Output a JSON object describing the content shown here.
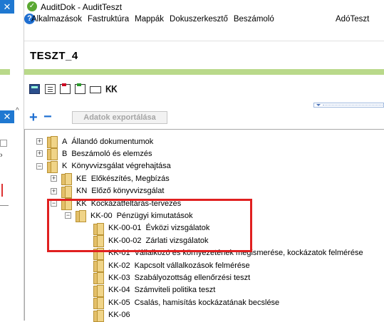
{
  "window": {
    "title": "AuditDok - AuditTeszt"
  },
  "menu": {
    "items": [
      "Alkalmazások",
      "Fastruktúra",
      "Mappák",
      "Dokuszerkesztő",
      "Beszámoló"
    ],
    "right_item": "AdóTeszt"
  },
  "document": {
    "title": "TESZT_4"
  },
  "toolbar": {
    "kk_label": "KK"
  },
  "actions": {
    "export_label": "Adatok exportálása"
  },
  "tree": {
    "nodes": [
      {
        "code": "A",
        "label": "Állandó dokumentumok",
        "level": 0,
        "expander": "+"
      },
      {
        "code": "B",
        "label": "Beszámoló és elemzés",
        "level": 0,
        "expander": "+"
      },
      {
        "code": "K",
        "label": "Könyvvizsgálat végrehajtása",
        "level": 0,
        "expander": "−"
      },
      {
        "code": "KE",
        "label": "Előkészítés, Megbízás",
        "level": 1,
        "expander": "+"
      },
      {
        "code": "KN",
        "label": "Előző könyvvizsgálat",
        "level": 1,
        "expander": "+"
      },
      {
        "code": "KK",
        "label": "Kockázatfeltárás-tervezés",
        "level": 1,
        "expander": "−"
      },
      {
        "code": "KK-00",
        "label": "Pénzügyi kimutatások",
        "level": 2,
        "expander": "−"
      },
      {
        "code": "KK-00-01",
        "label": "Évközi vizsgálatok",
        "level": 3,
        "expander": ""
      },
      {
        "code": "KK-00-02",
        "label": "Zárlati vizsgálatok",
        "level": 3,
        "expander": ""
      },
      {
        "code": "KK-01",
        "label": "Vállalkozó és környezetének megismerése, kockázatok felmérése",
        "level": 3,
        "expander": ""
      },
      {
        "code": "KK-02",
        "label": "Kapcsolt vállalkozások felmérése",
        "level": 3,
        "expander": ""
      },
      {
        "code": "KK-03",
        "label": "Szabályozottság ellenőrzési teszt",
        "level": 3,
        "expander": ""
      },
      {
        "code": "KK-04",
        "label": "Számviteli politika teszt",
        "level": 3,
        "expander": ""
      },
      {
        "code": "KK-05",
        "label": "Csalás, hamisítás kockázatának becslése",
        "level": 3,
        "expander": ""
      },
      {
        "code": "KK-06",
        "label": "",
        "level": 3,
        "expander": ""
      }
    ]
  },
  "colors": {
    "accent_green": "#b9d98a",
    "highlight_red": "#e02020",
    "brand_blue": "#1f6fd1",
    "folder_yellow": "#f0d488"
  }
}
